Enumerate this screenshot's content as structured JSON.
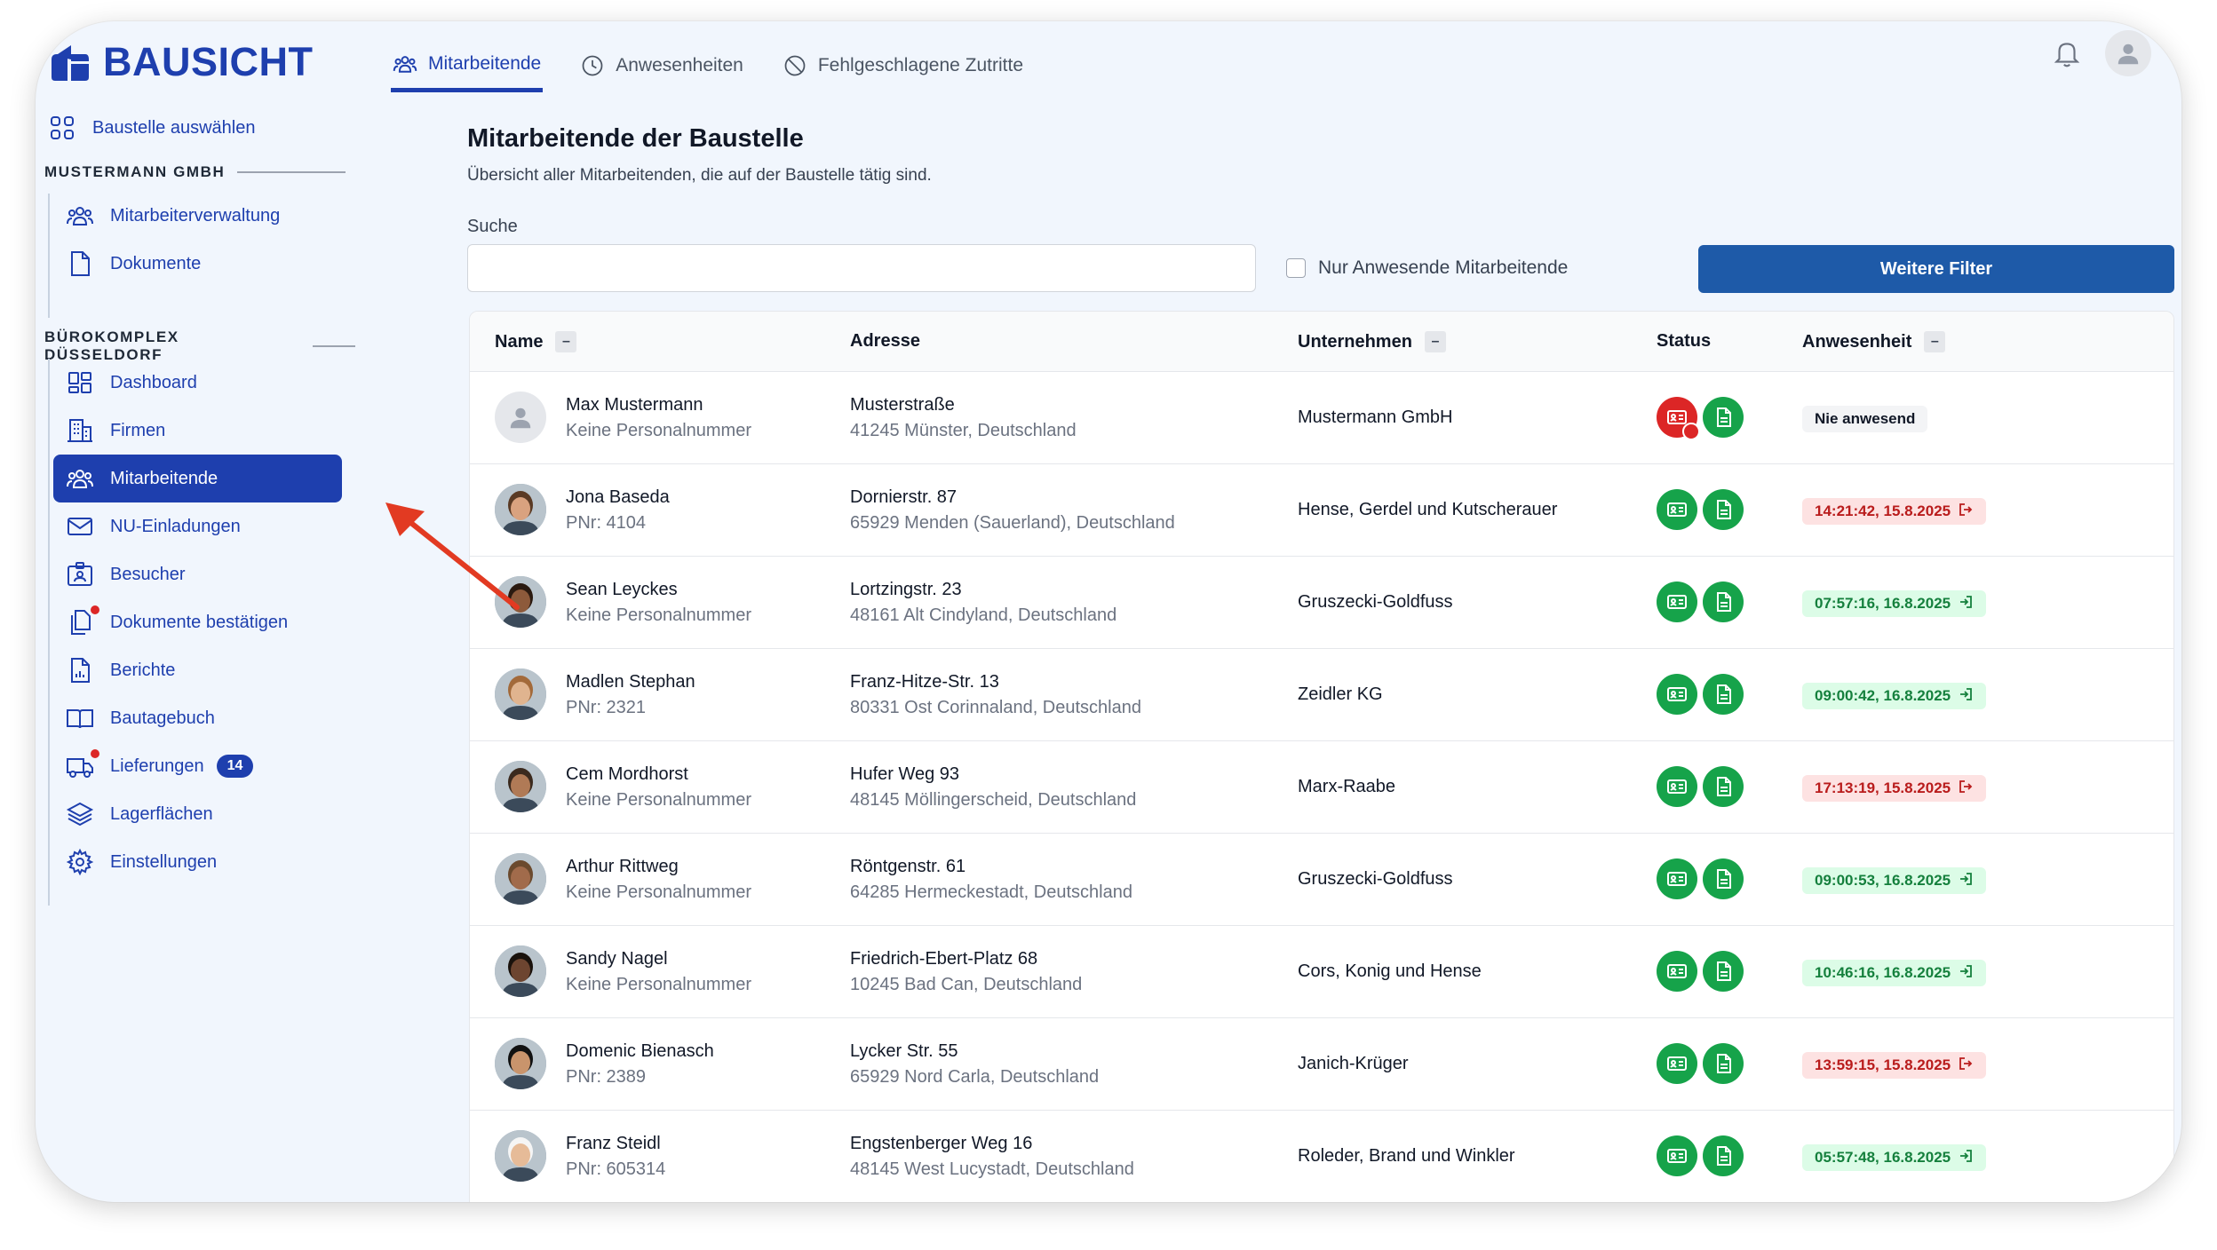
{
  "app": {
    "name": "BAUSICHT",
    "brand_color": "#1e3fae"
  },
  "tabs": [
    {
      "label": "Mitarbeitende",
      "icon": "users-icon",
      "active": true
    },
    {
      "label": "Anwesenheiten",
      "icon": "clock-icon",
      "active": false
    },
    {
      "label": "Fehlgeschlagene Zutritte",
      "icon": "ban-icon",
      "active": false
    }
  ],
  "sidebar": {
    "select_site": "Baustelle auswählen",
    "company_section": "MUSTERMANN GMBH",
    "company_items": [
      {
        "label": "Mitarbeiterverwaltung",
        "icon": "users-icon"
      },
      {
        "label": "Dokumente",
        "icon": "document-icon"
      }
    ],
    "site_section": "BÜROKOMPLEX DÜSSELDORF",
    "site_items": [
      {
        "label": "Dashboard",
        "icon": "dashboard-icon"
      },
      {
        "label": "Firmen",
        "icon": "building-icon"
      },
      {
        "label": "Mitarbeitende",
        "icon": "users-icon",
        "active": true
      },
      {
        "label": "NU-Einladungen",
        "icon": "mail-icon"
      },
      {
        "label": "Besucher",
        "icon": "visitor-icon"
      },
      {
        "label": "Dokumente bestätigen",
        "icon": "documents-icon",
        "notification_dot": true
      },
      {
        "label": "Berichte",
        "icon": "report-icon"
      },
      {
        "label": "Bautagebuch",
        "icon": "book-icon"
      },
      {
        "label": "Lieferungen",
        "icon": "truck-icon",
        "notification_dot": true,
        "count": "14"
      },
      {
        "label": "Lagerflächen",
        "icon": "layers-icon"
      },
      {
        "label": "Einstellungen",
        "icon": "gear-icon"
      }
    ]
  },
  "main": {
    "title": "Mitarbeitende der Baustelle",
    "subtitle": "Übersicht aller Mitarbeitenden, die auf der Baustelle tätig sind.",
    "search_label": "Suche",
    "search_value": "",
    "checkbox_label": "Nur Anwesende Mitarbeitende",
    "filter_button": "Weitere Filter",
    "columns": {
      "name": "Name",
      "address": "Adresse",
      "company": "Unternehmen",
      "status": "Status",
      "attendance": "Anwesenheit",
      "sort_symbol": "–"
    },
    "rows": [
      {
        "name": "Max Mustermann",
        "pnr": "Keine Personalnummer",
        "street": "Musterstraße",
        "city": "41245 Münster, Deutschland",
        "company": "Mustermann GmbH",
        "id_status": "red",
        "doc_status": "green",
        "attendance": "Nie anwesend",
        "attendance_type": "none",
        "placeholder_avatar": true
      },
      {
        "name": "Jona Baseda",
        "pnr": "PNr: 4104",
        "street": "Dornierstr. 87",
        "city": "65929 Menden (Sauerland), Deutschland",
        "company": "Hense, Gerdel und Kutscherauer",
        "id_status": "green",
        "doc_status": "green",
        "attendance": "14:21:42, 15.8.2025",
        "attendance_type": "out"
      },
      {
        "name": "Sean Leyckes",
        "pnr": "Keine Personalnummer",
        "street": "Lortzingstr. 23",
        "city": "48161 Alt Cindyland, Deutschland",
        "company": "Gruszecki-Goldfuss",
        "id_status": "green",
        "doc_status": "green",
        "attendance": "07:57:16, 16.8.2025",
        "attendance_type": "in"
      },
      {
        "name": "Madlen Stephan",
        "pnr": "PNr: 2321",
        "street": "Franz-Hitze-Str. 13",
        "city": "80331 Ost Corinnaland, Deutschland",
        "company": "Zeidler KG",
        "id_status": "green",
        "doc_status": "green",
        "attendance": "09:00:42, 16.8.2025",
        "attendance_type": "in"
      },
      {
        "name": "Cem Mordhorst",
        "pnr": "Keine Personalnummer",
        "street": "Hufer Weg 93",
        "city": "48145 Möllingerscheid, Deutschland",
        "company": "Marx-Raabe",
        "id_status": "green",
        "doc_status": "green",
        "attendance": "17:13:19, 15.8.2025",
        "attendance_type": "out"
      },
      {
        "name": "Arthur Rittweg",
        "pnr": "Keine Personalnummer",
        "street": "Röntgenstr. 61",
        "city": "64285 Hermeckestadt, Deutschland",
        "company": "Gruszecki-Goldfuss",
        "id_status": "green",
        "doc_status": "green",
        "attendance": "09:00:53, 16.8.2025",
        "attendance_type": "in"
      },
      {
        "name": "Sandy Nagel",
        "pnr": "Keine Personalnummer",
        "street": "Friedrich-Ebert-Platz 68",
        "city": "10245 Bad Can, Deutschland",
        "company": "Cors, Konig und Hense",
        "id_status": "green",
        "doc_status": "green",
        "attendance": "10:46:16, 16.8.2025",
        "attendance_type": "in"
      },
      {
        "name": "Domenic Bienasch",
        "pnr": "PNr: 2389",
        "street": "Lycker Str. 55",
        "city": "65929 Nord Carla, Deutschland",
        "company": "Janich-Krüger",
        "id_status": "green",
        "doc_status": "green",
        "attendance": "13:59:15, 15.8.2025",
        "attendance_type": "out"
      },
      {
        "name": "Franz Steidl",
        "pnr": "PNr: 605314",
        "street": "Engstenberger Weg 16",
        "city": "48145 West Lucystadt, Deutschland",
        "company": "Roleder, Brand und Winkler",
        "id_status": "green",
        "doc_status": "green",
        "attendance": "05:57:48, 16.8.2025",
        "attendance_type": "in"
      }
    ]
  },
  "colors": {
    "status_green": "#16a34a",
    "status_red": "#dc2626",
    "attendance_in_bg": "#dcfce7",
    "attendance_out_bg": "#fde2e2",
    "annotation_arrow": "#e23a22"
  }
}
